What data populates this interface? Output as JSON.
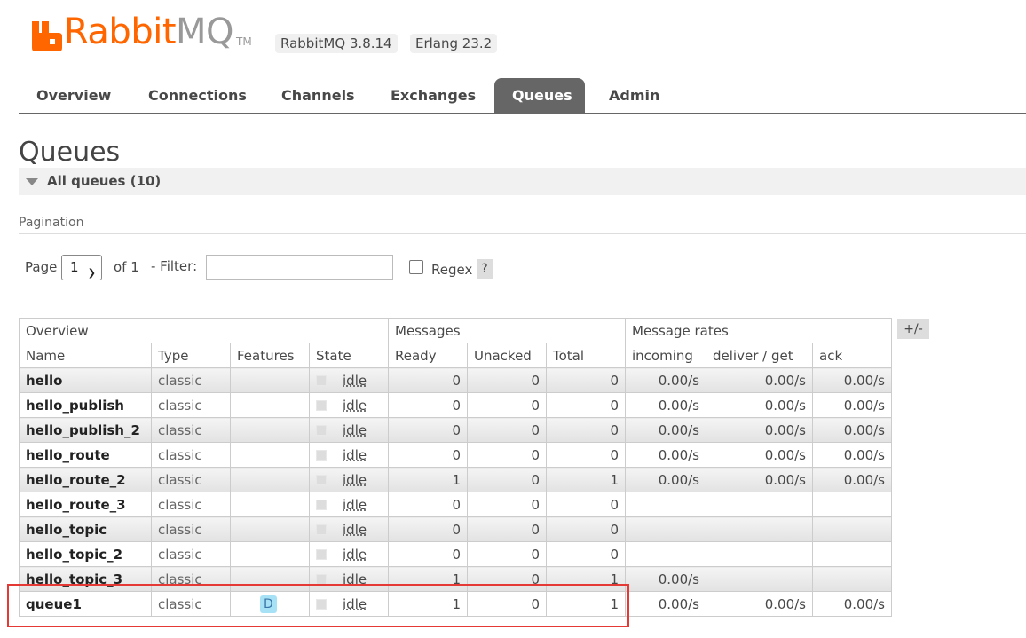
{
  "header": {
    "logo_rabbit": "Rabbit",
    "logo_mq": "MQ",
    "logo_tm": "TM",
    "rabbitmq_version": "RabbitMQ 3.8.14",
    "erlang_version": "Erlang 23.2"
  },
  "tabs": [
    {
      "label": "Overview",
      "active": false
    },
    {
      "label": "Connections",
      "active": false
    },
    {
      "label": "Channels",
      "active": false
    },
    {
      "label": "Exchanges",
      "active": false
    },
    {
      "label": "Queues",
      "active": true
    },
    {
      "label": "Admin",
      "active": false
    }
  ],
  "page_title": "Queues",
  "section_label": "All queues (10)",
  "pagination": {
    "label": "Pagination",
    "page_label": "Page",
    "page_value": "1",
    "of_label": "of 1",
    "filter_label": "- Filter:",
    "filter_value": "",
    "regex_label": "Regex",
    "help": "?"
  },
  "table": {
    "groups": [
      "Overview",
      "Messages",
      "Message rates"
    ],
    "columns": [
      "Name",
      "Type",
      "Features",
      "State",
      "Ready",
      "Unacked",
      "Total",
      "incoming",
      "deliver / get",
      "ack"
    ],
    "toggle": "+/-",
    "rows": [
      {
        "name": "hello",
        "type": "classic",
        "features": "",
        "state": "idle",
        "ready": "0",
        "unacked": "0",
        "total": "0",
        "incoming": "0.00/s",
        "deliver": "0.00/s",
        "ack": "0.00/s"
      },
      {
        "name": "hello_publish",
        "type": "classic",
        "features": "",
        "state": "idle",
        "ready": "0",
        "unacked": "0",
        "total": "0",
        "incoming": "0.00/s",
        "deliver": "0.00/s",
        "ack": "0.00/s"
      },
      {
        "name": "hello_publish_2",
        "type": "classic",
        "features": "",
        "state": "idle",
        "ready": "0",
        "unacked": "0",
        "total": "0",
        "incoming": "0.00/s",
        "deliver": "0.00/s",
        "ack": "0.00/s"
      },
      {
        "name": "hello_route",
        "type": "classic",
        "features": "",
        "state": "idle",
        "ready": "0",
        "unacked": "0",
        "total": "0",
        "incoming": "0.00/s",
        "deliver": "0.00/s",
        "ack": "0.00/s"
      },
      {
        "name": "hello_route_2",
        "type": "classic",
        "features": "",
        "state": "idle",
        "ready": "1",
        "unacked": "0",
        "total": "1",
        "incoming": "0.00/s",
        "deliver": "0.00/s",
        "ack": "0.00/s"
      },
      {
        "name": "hello_route_3",
        "type": "classic",
        "features": "",
        "state": "idle",
        "ready": "0",
        "unacked": "0",
        "total": "0",
        "incoming": "",
        "deliver": "",
        "ack": ""
      },
      {
        "name": "hello_topic",
        "type": "classic",
        "features": "",
        "state": "idle",
        "ready": "0",
        "unacked": "0",
        "total": "0",
        "incoming": "",
        "deliver": "",
        "ack": ""
      },
      {
        "name": "hello_topic_2",
        "type": "classic",
        "features": "",
        "state": "idle",
        "ready": "0",
        "unacked": "0",
        "total": "0",
        "incoming": "",
        "deliver": "",
        "ack": ""
      },
      {
        "name": "hello_topic_3",
        "type": "classic",
        "features": "",
        "state": "idle",
        "ready": "1",
        "unacked": "0",
        "total": "1",
        "incoming": "0.00/s",
        "deliver": "",
        "ack": ""
      },
      {
        "name": "queue1",
        "type": "classic",
        "features": "D",
        "state": "idle",
        "ready": "1",
        "unacked": "0",
        "total": "1",
        "incoming": "0.00/s",
        "deliver": "0.00/s",
        "ack": "0.00/s"
      }
    ]
  },
  "colors": {
    "brand_orange": "#ff6600",
    "active_tab": "#666666",
    "highlight": "#e53935",
    "badge_d": "#a7e1f5"
  }
}
